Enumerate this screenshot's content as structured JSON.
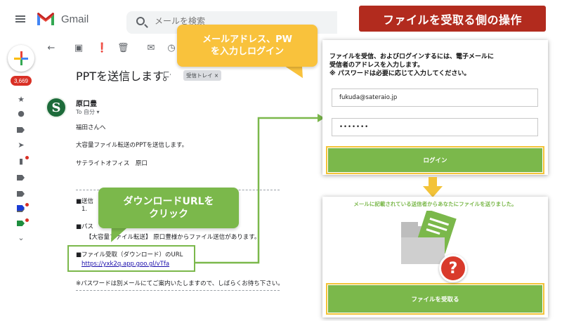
{
  "banner": {
    "title": "ファイルを受取る側の操作"
  },
  "gmail": {
    "brand": "Gmail",
    "search_placeholder": "メールを検索",
    "inbox_count": "3,669"
  },
  "email": {
    "subject": "PPTを送信します。",
    "label_chip": "受信トレイ ×",
    "sender": "原口豊",
    "to_me": "To 自分 ▾",
    "avatar_letter": "S",
    "greeting": "福田さんへ",
    "line1": "大容量ファイル転送のPPTを送信します。",
    "signature": "サテライトオフィス　原口",
    "send_label": "■送信",
    "item_1": "1.",
    "pass_label": "■パス",
    "notice": "【大容量ファイル転送】 原口豊様からファイル送信があります。",
    "url_label": "■ファイル受取（ダウンロード）のURL",
    "url": "https://yxk2q.app.goo.gl/vTfa",
    "password_note": "※パスワードは別メールにてご案内いたしますので、しばらくお待ち下さい。"
  },
  "callouts": {
    "login_line1": "メールアドレス、PW",
    "login_line2": "を入力しログイン",
    "download_line1": "ダウンロードURLを",
    "download_line2": "クリック"
  },
  "login_panel": {
    "instruction_line1": "ファイルを受信、およびログインするには、電子メールに",
    "instruction_line2": "受信者のアドレスを入力します。",
    "instruction_line3": "※ パスワードは必要に応じて入力してください。",
    "email_value": "fukuda@sateraio.jp",
    "password_value": "•••••••",
    "login_button": "ログイン"
  },
  "download_panel": {
    "message": "メールに記載されている送信者からあなたにファイルを送りました。",
    "receive_button": "ファイルを受取る"
  },
  "colors": {
    "banner_red": "#b22b1e",
    "callout_yellow": "#f9c23c",
    "action_green": "#7bb84b",
    "highlight_gold": "#f3c338",
    "question_red": "#d93a2b"
  }
}
